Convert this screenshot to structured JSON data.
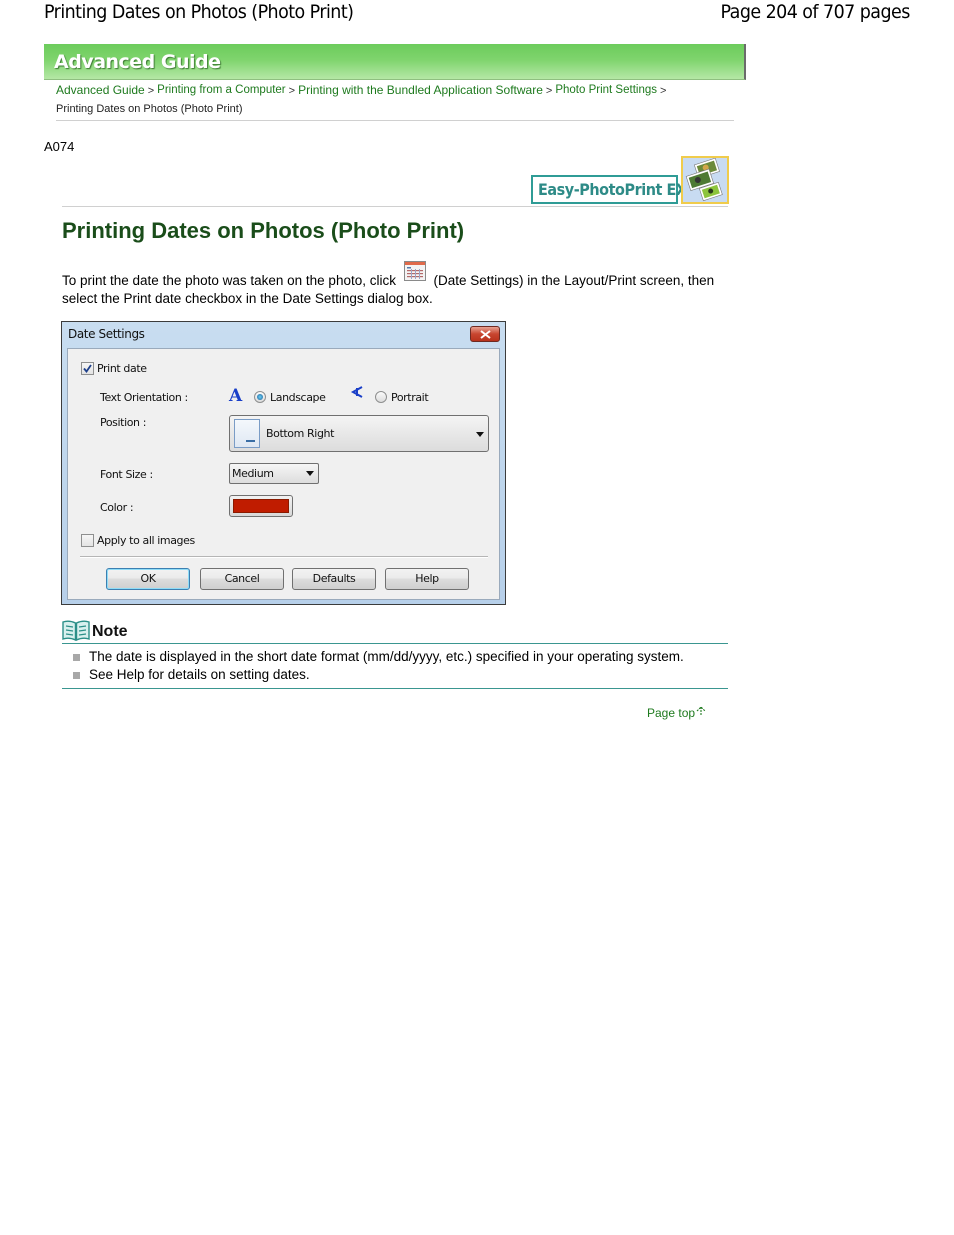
{
  "document": {
    "header_title": "Printing Dates on Photos (Photo Print)",
    "page_indicator": "Page 204 of 707 pages"
  },
  "banner": {
    "label": "Advanced Guide"
  },
  "breadcrumb": {
    "items": [
      {
        "label": "Advanced Guide"
      },
      {
        "label": "Printing from a Computer"
      },
      {
        "label": "Printing with the Bundled Application Software"
      },
      {
        "label": "Photo Print Settings"
      }
    ],
    "separator": ">",
    "current": "Printing Dates on Photos (Photo Print)"
  },
  "doc_code": "A074",
  "product_logo": {
    "label": "Easy-PhotoPrint EX",
    "icon": "photos-stack-icon"
  },
  "page_title": "Printing Dates on Photos (Photo Print)",
  "intro": {
    "before_icon": "To print the date the photo was taken on the photo, click",
    "icon": "date-settings-icon",
    "after_icon": "(Date Settings) in the Layout/Print screen, then select the Print date checkbox in the Date Settings dialog box."
  },
  "dialog": {
    "title": "Date Settings",
    "print_date": {
      "label": "Print date",
      "checked": true
    },
    "text_orientation": {
      "label": "Text Orientation :",
      "options": [
        {
          "label": "Landscape",
          "selected": true
        },
        {
          "label": "Portrait",
          "selected": false
        }
      ]
    },
    "position": {
      "label": "Position :",
      "value": "Bottom Right"
    },
    "font_size": {
      "label": "Font Size :",
      "value": "Medium"
    },
    "color": {
      "label": "Color :",
      "value": "#c01c00"
    },
    "apply_all": {
      "label": "Apply to all images",
      "checked": false
    },
    "buttons": {
      "ok": "OK",
      "cancel": "Cancel",
      "defaults": "Defaults",
      "help": "Help"
    }
  },
  "note": {
    "heading": "Note",
    "items": [
      "The date is displayed in the short date format (mm/dd/yyyy, etc.) specified in your operating system.",
      "See Help for details on setting dates."
    ]
  },
  "page_top": {
    "label": "Page top"
  },
  "colors": {
    "link_green": "#1e7a1e",
    "title_green": "#1a4d1a",
    "note_rule": "#3a9690",
    "banner_green": "#6ccc5c"
  }
}
